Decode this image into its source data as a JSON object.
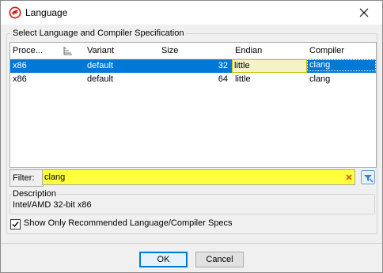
{
  "window": {
    "title": "Language",
    "icon": "dragon-icon",
    "close_icon": "close-icon"
  },
  "group": {
    "legend": "Select Language and Compiler Specification"
  },
  "table": {
    "columns": [
      "Proce...",
      "Variant",
      "Size",
      "Endian",
      "Compiler"
    ],
    "sort_icon": "sort-indicator-icon",
    "rows": [
      {
        "processor": "x86",
        "variant": "default",
        "size": "32",
        "endian": "little",
        "compiler": "clang",
        "selected": true
      },
      {
        "processor": "x86",
        "variant": "default",
        "size": "64",
        "endian": "little",
        "compiler": "clang",
        "selected": false
      }
    ]
  },
  "filter": {
    "label": "Filter:",
    "value": "clang",
    "clear_icon": "clear-x-icon",
    "action_icon": "filter-options-icon",
    "highlight_color": "#ffff3d"
  },
  "description": {
    "legend": "Description",
    "text": "Intel/AMD 32-bit x86"
  },
  "checkbox": {
    "label": "Show Only Recommended Language/Compiler Specs",
    "checked": true
  },
  "buttons": {
    "ok_label": "OK",
    "cancel_label": "Cancel"
  },
  "colors": {
    "selection": "#0078d7",
    "edit_cell_border": "#c6c200"
  }
}
